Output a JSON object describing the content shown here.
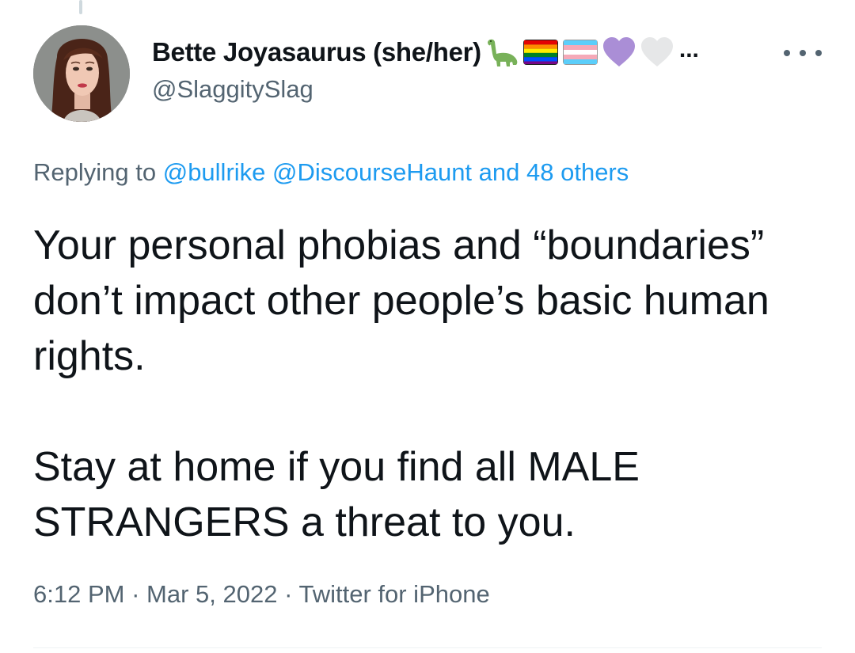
{
  "tweet": {
    "author": {
      "display_name": "Bette Joyasaurus (she/her)",
      "name_truncation": "...",
      "handle": "@SlaggitySlag",
      "name_emojis": [
        "sauropod-emoji",
        "rainbow-flag-emoji",
        "transgender-flag-emoji",
        "purple-heart-emoji",
        "white-heart-emoji"
      ]
    },
    "replying": {
      "prefix": "Replying to",
      "mention_1": "@bullrike",
      "mention_2": "@DiscourseHaunt",
      "others": "and 48 others"
    },
    "text": {
      "paragraph_1": "Your personal phobias and “boundaries” don’t impact other people’s basic human rights.",
      "paragraph_2": "Stay at home if you find all MALE STRANGERS a threat to you."
    },
    "meta": {
      "time": "6:12 PM",
      "separator": "·",
      "date": "Mar 5, 2022",
      "source": "Twitter for iPhone"
    }
  },
  "icons": {
    "more": "more-horizontal-icon"
  },
  "colors": {
    "link": "#1d9bf0",
    "secondary_text": "#536471",
    "primary_text": "#0f1419"
  }
}
